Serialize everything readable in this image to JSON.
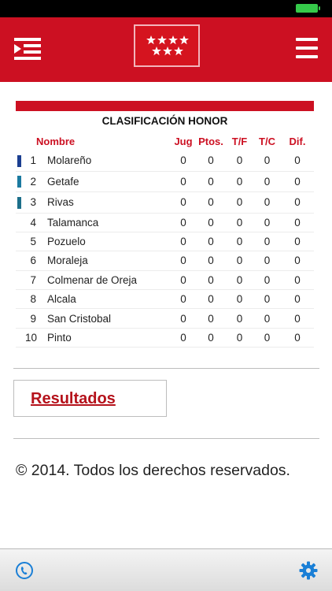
{
  "colors": {
    "brand_red": "#cc1022",
    "header_text_red": "#cc1022",
    "link_red": "#b5121b",
    "gear_blue": "#1a7fd6"
  },
  "navbar": {
    "left_icon": "menu-list-icon",
    "center_icon": "madrid-flag-logo",
    "right_icon": "hamburger-menu-icon"
  },
  "standings": {
    "title": "CLASIFICACIÓN HONOR",
    "headers": {
      "name": "Nombre",
      "jug": "Jug",
      "ptos": "Ptos.",
      "tf": "T/F",
      "tc": "T/C",
      "dif": "Dif."
    },
    "rows": [
      {
        "pos": "1",
        "name": "Molareño",
        "jug": "0",
        "ptos": "0",
        "tf": "0",
        "tc": "0",
        "dif": "0",
        "mark": "#1b3f91"
      },
      {
        "pos": "2",
        "name": "Getafe",
        "jug": "0",
        "ptos": "0",
        "tf": "0",
        "tc": "0",
        "dif": "0",
        "mark": "#1b7aa0"
      },
      {
        "pos": "3",
        "name": "Rivas",
        "jug": "0",
        "ptos": "0",
        "tf": "0",
        "tc": "0",
        "dif": "0",
        "mark": "#1c6f8a"
      },
      {
        "pos": "4",
        "name": "Talamanca",
        "jug": "0",
        "ptos": "0",
        "tf": "0",
        "tc": "0",
        "dif": "0",
        "mark": ""
      },
      {
        "pos": "5",
        "name": "Pozuelo",
        "jug": "0",
        "ptos": "0",
        "tf": "0",
        "tc": "0",
        "dif": "0",
        "mark": ""
      },
      {
        "pos": "6",
        "name": "Moraleja",
        "jug": "0",
        "ptos": "0",
        "tf": "0",
        "tc": "0",
        "dif": "0",
        "mark": ""
      },
      {
        "pos": "7",
        "name": "Colmenar de Oreja",
        "jug": "0",
        "ptos": "0",
        "tf": "0",
        "tc": "0",
        "dif": "0",
        "mark": ""
      },
      {
        "pos": "8",
        "name": "Alcala",
        "jug": "0",
        "ptos": "0",
        "tf": "0",
        "tc": "0",
        "dif": "0",
        "mark": ""
      },
      {
        "pos": "9",
        "name": "San Cristobal",
        "jug": "0",
        "ptos": "0",
        "tf": "0",
        "tc": "0",
        "dif": "0",
        "mark": ""
      },
      {
        "pos": "10",
        "name": "Pinto",
        "jug": "0",
        "ptos": "0",
        "tf": "0",
        "tc": "0",
        "dif": "0",
        "mark": ""
      }
    ]
  },
  "results_button": {
    "label": "Resultados"
  },
  "footer": {
    "copyright": "© 2014. Todos los derechos reservados."
  },
  "toolbar": {
    "left_icon": "phone-icon",
    "right_icon": "gear-icon"
  }
}
